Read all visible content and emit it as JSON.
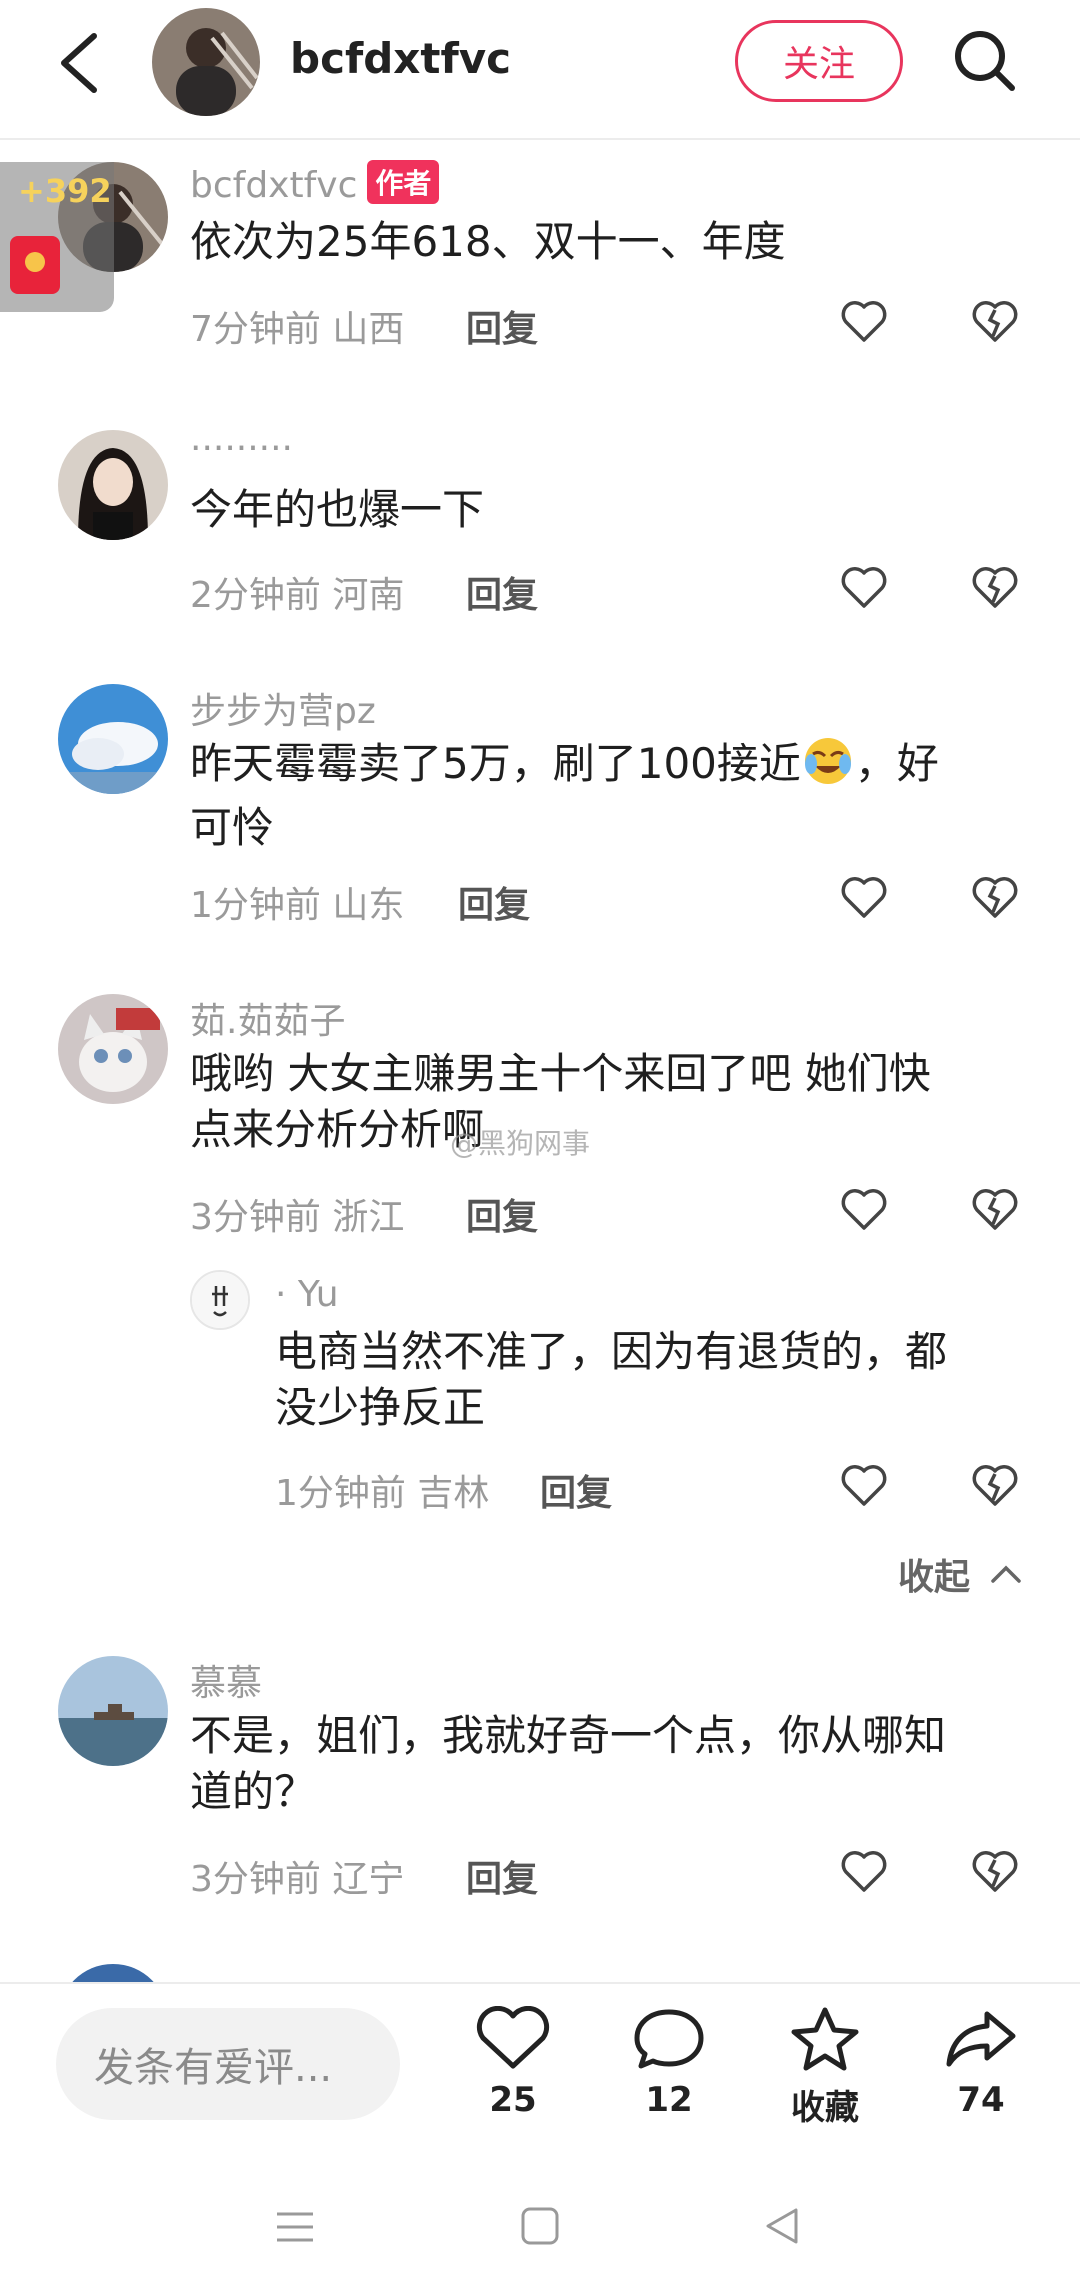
{
  "header": {
    "username": "bcfdxtfvc",
    "follow_label": "关注"
  },
  "floating_badge": {
    "count": "+392"
  },
  "comments": [
    {
      "username": "bcfdxtfvc",
      "author_tag": "作者",
      "text": "依次为25年618、双十一、年度",
      "time_location": "7分钟前 山西",
      "reply_label": "回复"
    },
    {
      "username": "·········",
      "text": "今年的也爆一下",
      "time_location": "2分钟前 河南",
      "reply_label": "回复"
    },
    {
      "username": "步步为营pz",
      "text_line1": "昨天霉霉卖了5万，刷了100接近",
      "text_line1_end": "，好",
      "text_line2": "可怜",
      "time_location": "1分钟前 山东",
      "reply_label": "回复"
    },
    {
      "username": "茹.茹茹子",
      "text_line1": "哦哟 大女主赚男主十个来回了吧 她们快",
      "text_line2": "点来分析分析啊",
      "time_location": "3分钟前 浙江",
      "reply_label": "回复"
    },
    {
      "username": "· Yu",
      "text_line1": "电商当然不准了，因为有退货的，都",
      "text_line2": "没少挣反正",
      "time_location": "1分钟前 吉林",
      "reply_label": "回复"
    },
    {
      "username": "慕慕",
      "text_line1": "不是，姐们，我就好奇一个点，你从哪知",
      "text_line2": "道的？",
      "time_location": "3分钟前 辽宁",
      "reply_label": "回复"
    }
  ],
  "collapse_label": "收起",
  "watermark": "@黑狗网事",
  "bottom_bar": {
    "input_placeholder": "发条有爱评...",
    "like_count": "25",
    "comment_count": "12",
    "favorite_label": "收藏",
    "share_count": "74"
  },
  "colors": {
    "accent": "#e8355d",
    "author_tag": "#f0325c",
    "meta_gray": "#9a9a9a"
  }
}
